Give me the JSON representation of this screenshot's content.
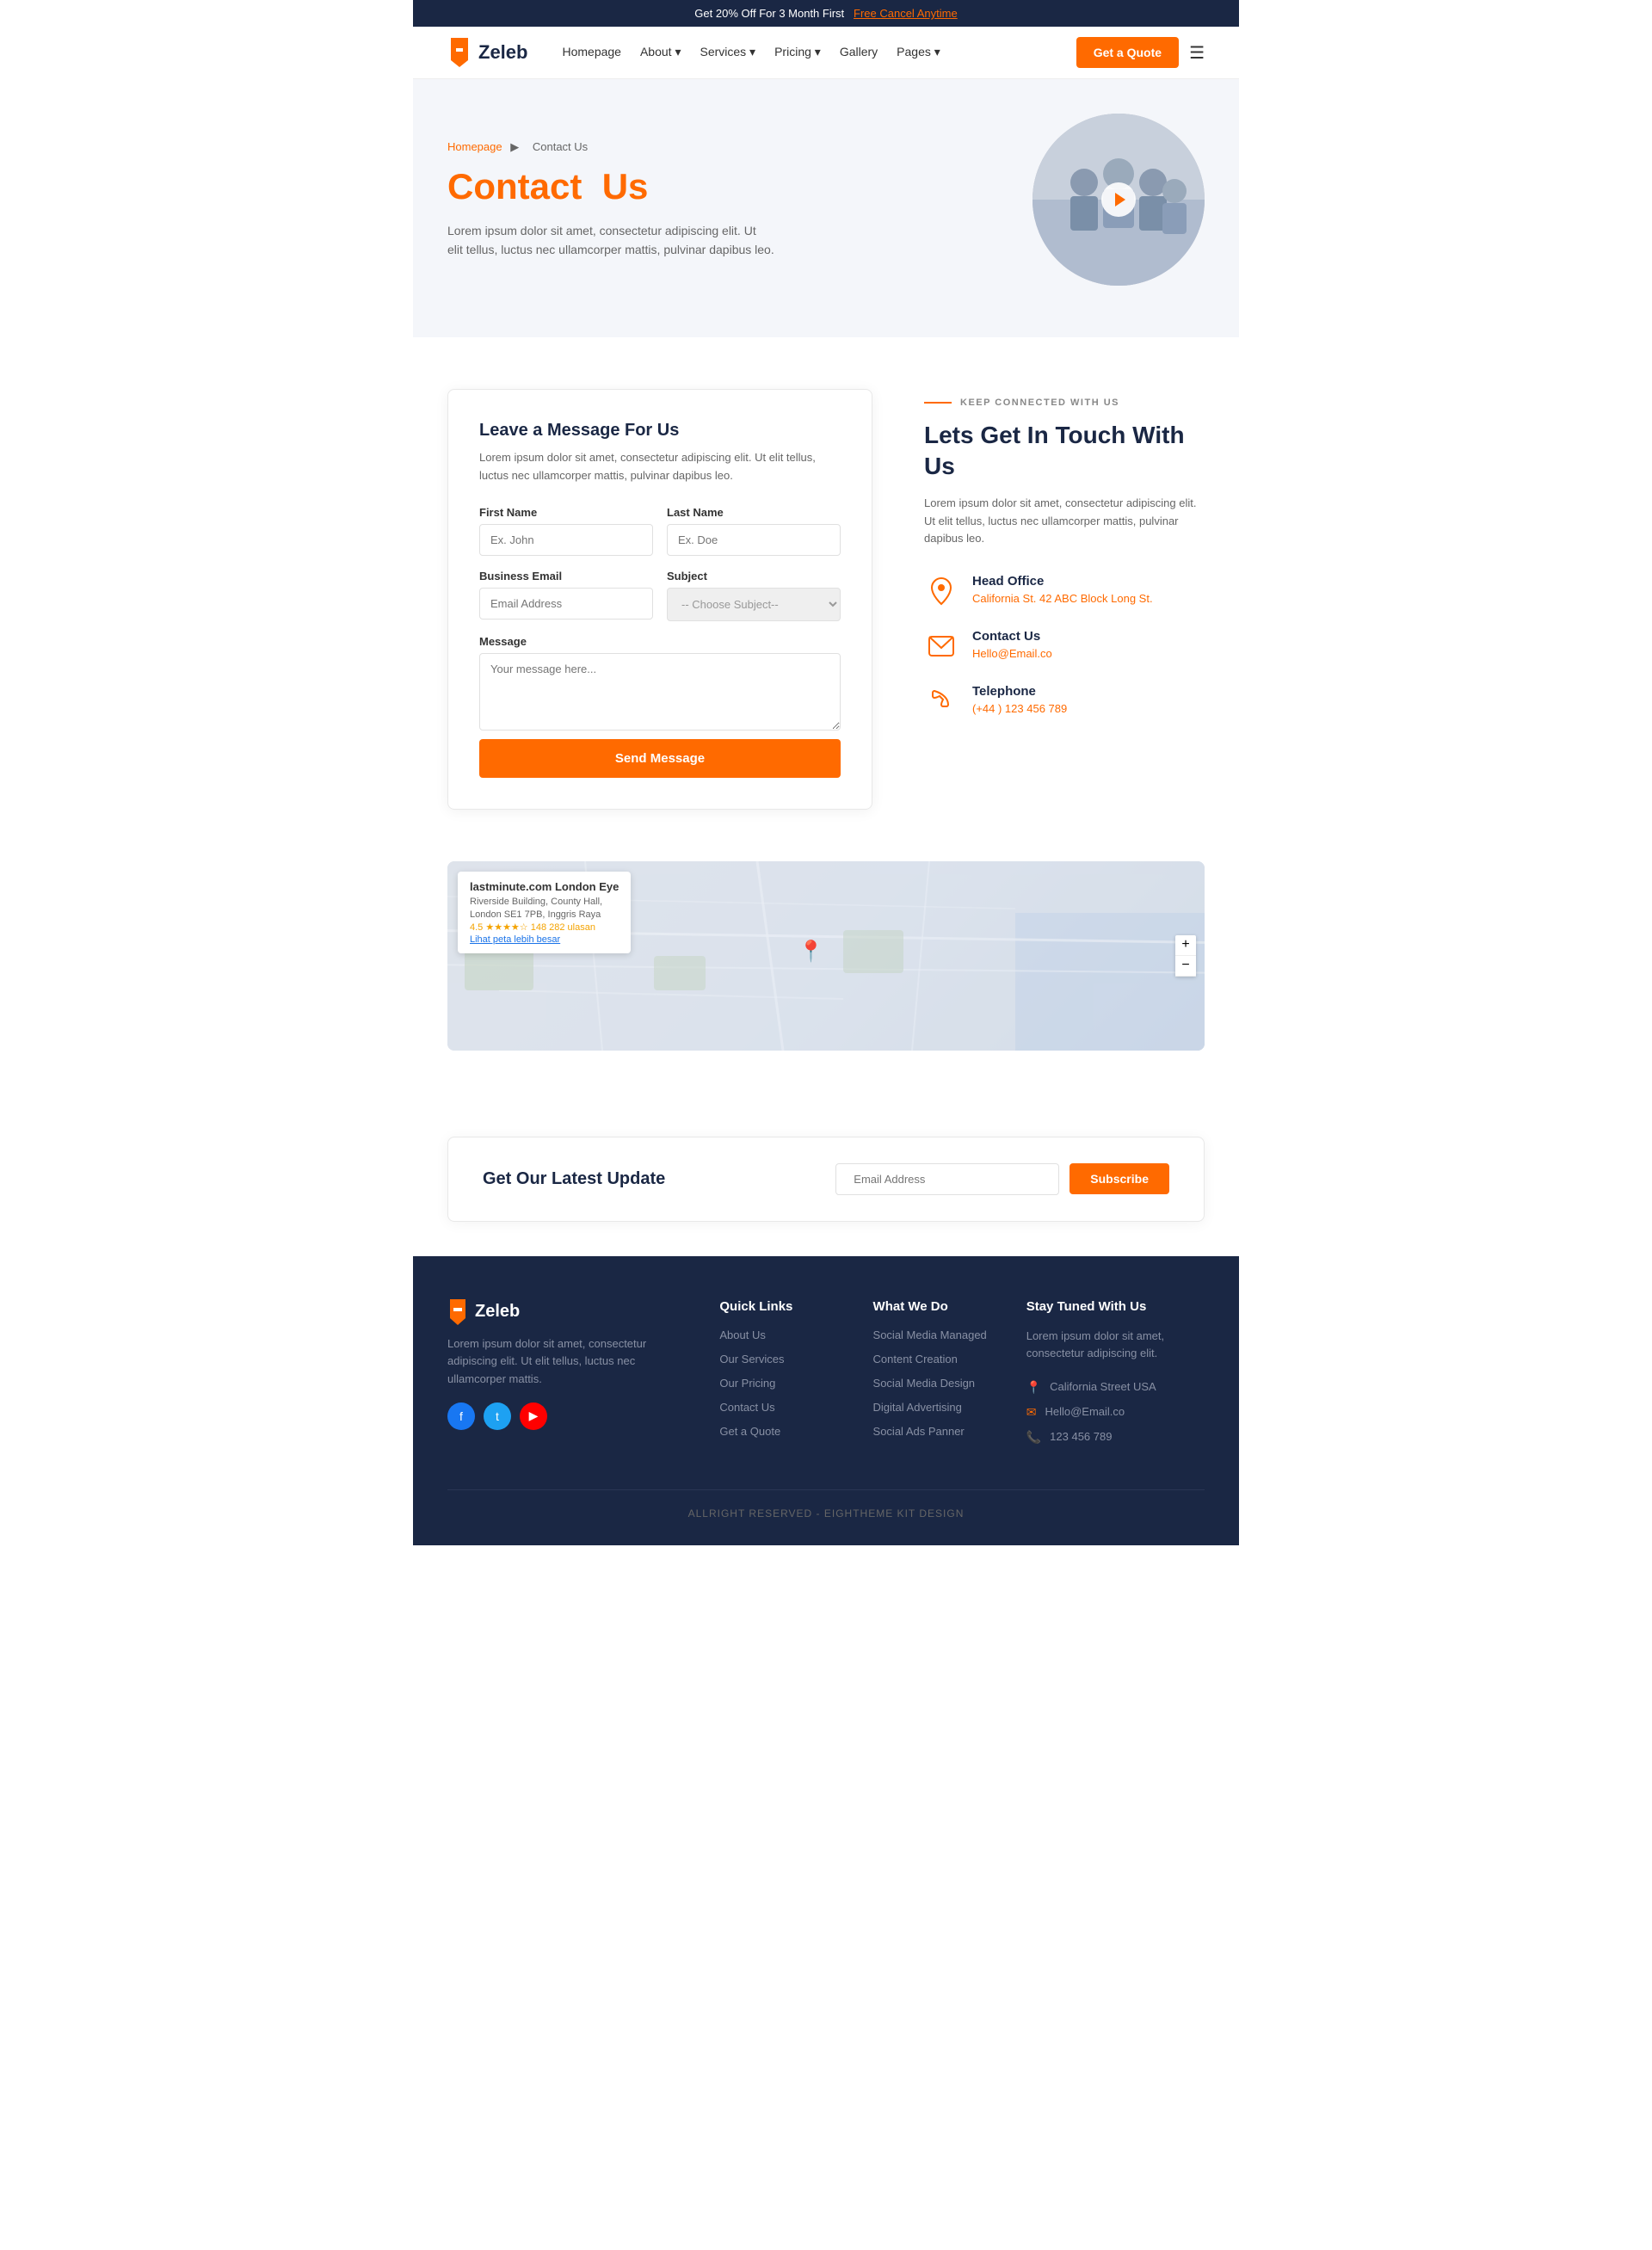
{
  "banner": {
    "text": "Get 20% Off For 3 Month First",
    "link_text": "Free Cancel Anytime"
  },
  "nav": {
    "logo_text": "Zeleb",
    "links": [
      {
        "label": "Homepage",
        "has_dropdown": false
      },
      {
        "label": "About",
        "has_dropdown": true
      },
      {
        "label": "Services",
        "has_dropdown": true
      },
      {
        "label": "Pricing",
        "has_dropdown": true
      },
      {
        "label": "Gallery",
        "has_dropdown": false
      },
      {
        "label": "Pages",
        "has_dropdown": true
      }
    ],
    "cta_label": "Get a Quote"
  },
  "hero": {
    "breadcrumb_home": "Homepage",
    "breadcrumb_current": "Contact Us",
    "title_normal": "Contact",
    "title_highlight": "Us",
    "description": "Lorem ipsum dolor sit amet, consectetur adipiscing elit. Ut elit tellus, luctus nec ullamcorper mattis, pulvinar dapibus leo."
  },
  "form_section": {
    "title": "Leave a Message For Us",
    "description": "Lorem ipsum dolor sit amet, consectetur adipiscing elit. Ut elit tellus, luctus nec ullamcorper mattis, pulvinar dapibus leo.",
    "first_name_label": "First Name",
    "first_name_placeholder": "Ex. John",
    "last_name_label": "Last Name",
    "last_name_placeholder": "Ex. Doe",
    "email_label": "Business Email",
    "email_placeholder": "Email Address",
    "subject_label": "Subject",
    "subject_placeholder": "-- Choose Subject--",
    "message_label": "Message",
    "message_placeholder": "Your message here...",
    "send_button": "Send Message"
  },
  "contact_info": {
    "tag": "KEEP CONNECTED WITH US",
    "title": "Lets Get In Touch With Us",
    "description": "Lorem ipsum dolor sit amet, consectetur adipiscing elit. Ut elit tellus, luctus nec ullamcorper mattis, pulvinar dapibus leo.",
    "head_office_label": "Head Office",
    "head_office_value": "California St. 42 ABC Block Long St.",
    "contact_us_label": "Contact Us",
    "contact_us_value": "Hello@Email.co",
    "telephone_label": "Telephone",
    "telephone_value": "(+44 ) 123 456 789"
  },
  "map": {
    "overlay_title": "lastminute.com London Eye",
    "overlay_address": "Riverside Building, County Hall,\nLondon SE1 7PB, Inggris Raya",
    "rating": "4.5",
    "review_count": "148 282 ulasan",
    "view_map_link": "Lihat peta lebih besar"
  },
  "newsletter": {
    "title": "Get Our Latest Update",
    "email_placeholder": "Email Address",
    "button_label": "Subscribe"
  },
  "footer": {
    "brand_name": "Zeleb",
    "brand_description": "Lorem ipsum dolor sit amet, consectetur adipiscing elit. Ut elit tellus, luctus nec ullamcorper mattis.",
    "quick_links_title": "Quick Links",
    "quick_links": [
      {
        "label": "About Us"
      },
      {
        "label": "Our Services"
      },
      {
        "label": "Our Pricing"
      },
      {
        "label": "Contact Us"
      },
      {
        "label": "Get a Quote"
      }
    ],
    "what_we_do_title": "What We Do",
    "what_we_do": [
      {
        "label": "Social Media Managed"
      },
      {
        "label": "Content Creation"
      },
      {
        "label": "Social Media Design"
      },
      {
        "label": "Digital Advertising"
      },
      {
        "label": "Social Ads Panner"
      }
    ],
    "stay_tuned_title": "Stay Tuned With Us",
    "stay_tuned_description": "Lorem ipsum dolor sit amet, consectetur adipiscing elit.",
    "address": "California Street USA",
    "email": "Hello@Email.co",
    "phone": "123 456 789",
    "copyright": "ALLRIGHT RESERVED - EIGHTHEME KIT DESIGN"
  }
}
